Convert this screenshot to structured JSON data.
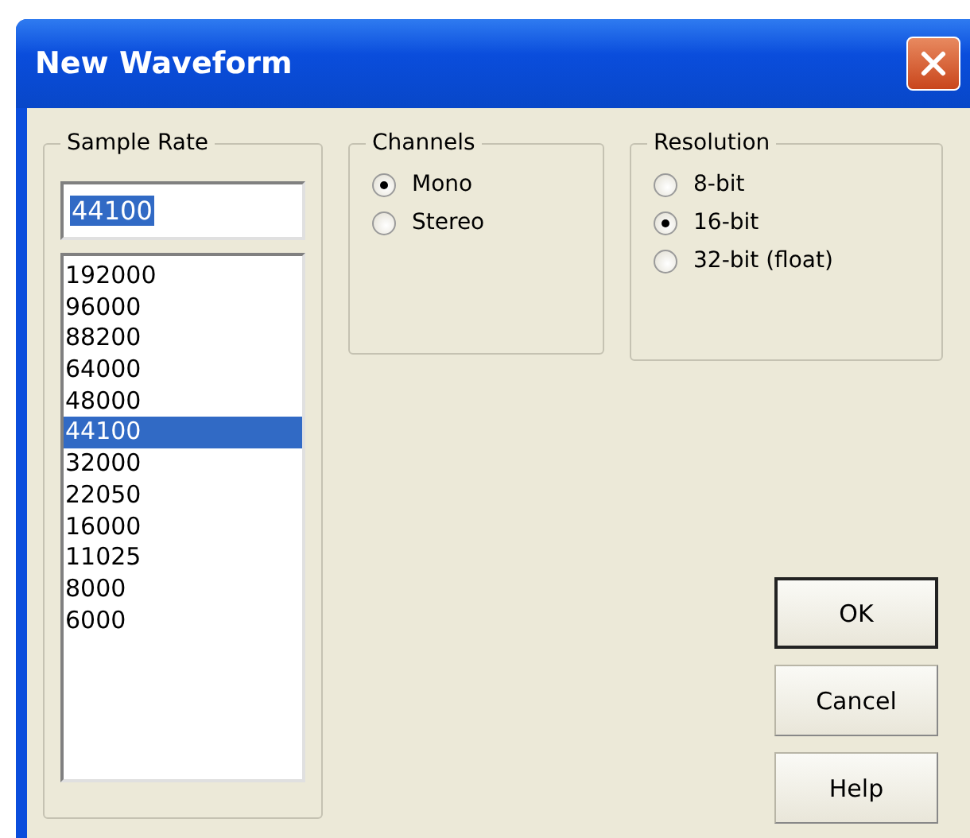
{
  "window": {
    "title": "New Waveform"
  },
  "sample_rate": {
    "label": "Sample Rate",
    "value": "44100",
    "options": [
      {
        "label": "192000",
        "selected": false
      },
      {
        "label": "96000",
        "selected": false
      },
      {
        "label": "88200",
        "selected": false
      },
      {
        "label": "64000",
        "selected": false
      },
      {
        "label": "48000",
        "selected": false
      },
      {
        "label": "44100",
        "selected": true
      },
      {
        "label": "32000",
        "selected": false
      },
      {
        "label": "22050",
        "selected": false
      },
      {
        "label": "16000",
        "selected": false
      },
      {
        "label": "11025",
        "selected": false
      },
      {
        "label": "8000",
        "selected": false
      },
      {
        "label": "6000",
        "selected": false
      }
    ]
  },
  "channels": {
    "label": "Channels",
    "options": [
      {
        "label": "Mono",
        "selected": true
      },
      {
        "label": "Stereo",
        "selected": false
      }
    ]
  },
  "resolution": {
    "label": "Resolution",
    "options": [
      {
        "label": "8-bit",
        "selected": false
      },
      {
        "label": "16-bit",
        "selected": true
      },
      {
        "label": "32-bit (float)",
        "selected": false
      }
    ]
  },
  "buttons": [
    {
      "label": "OK",
      "default": true
    },
    {
      "label": "Cancel",
      "default": false
    },
    {
      "label": "Help",
      "default": false
    }
  ]
}
